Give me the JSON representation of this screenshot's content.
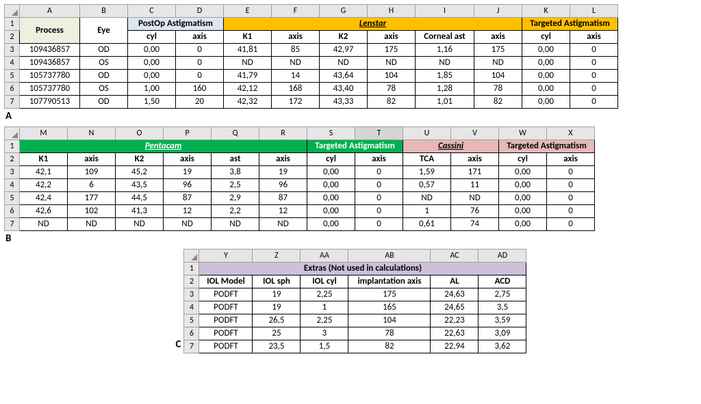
{
  "labels": {
    "A": "A",
    "B": "B",
    "C": "C"
  },
  "tableA": {
    "cols": [
      "A",
      "B",
      "C",
      "D",
      "E",
      "F",
      "G",
      "H",
      "I",
      "J",
      "K",
      "L"
    ],
    "widths": [
      88,
      70,
      70,
      70,
      70,
      70,
      70,
      70,
      86,
      70,
      70,
      70
    ],
    "rownums": [
      "1",
      "2",
      "3",
      "4",
      "5",
      "6",
      "7"
    ],
    "groups": {
      "process": "Process",
      "eye": "Eye",
      "postop": "PostOp Astigmatism",
      "lenstar": "Lenstar",
      "target": "Targeted Astigmatism"
    },
    "sub": [
      "cyl",
      "axis",
      "K1",
      "axis",
      "K2",
      "axis",
      "Corneal ast",
      "axis",
      "cyl",
      "axis"
    ],
    "rows": [
      [
        "109436857",
        "OD",
        "0,00",
        "0",
        "41,81",
        "85",
        "42,97",
        "175",
        "1,16",
        "175",
        "0,00",
        "0"
      ],
      [
        "109436857",
        "OS",
        "0,00",
        "0",
        "ND",
        "ND",
        "ND",
        "ND",
        "ND",
        "ND",
        "0,00",
        "0"
      ],
      [
        "105737780",
        "OD",
        "0,00",
        "0",
        "41,79",
        "14",
        "43,64",
        "104",
        "1,85",
        "104",
        "0,00",
        "0"
      ],
      [
        "105737780",
        "OS",
        "1,00",
        "160",
        "42,12",
        "168",
        "43,40",
        "78",
        "1,28",
        "78",
        "0,00",
        "0"
      ],
      [
        "107790513",
        "OD",
        "1,50",
        "20",
        "42,32",
        "172",
        "43,33",
        "82",
        "1,01",
        "82",
        "0,00",
        "0"
      ]
    ]
  },
  "tableB": {
    "cols": [
      "M",
      "N",
      "O",
      "P",
      "Q",
      "R",
      "S",
      "T",
      "U",
      "V",
      "W",
      "X"
    ],
    "widths": [
      70,
      70,
      70,
      70,
      70,
      70,
      70,
      70,
      70,
      70,
      70,
      70
    ],
    "rownums": [
      "1",
      "2",
      "3",
      "4",
      "5",
      "6",
      "7"
    ],
    "groups": {
      "pentacam": "Pentacam",
      "ptarget": "Targeted Astigmatism",
      "cassini": "Cassini",
      "ctarget": "Targeted Astigmatism"
    },
    "sub": [
      "K1",
      "axis",
      "K2",
      "axis",
      "ast",
      "axis",
      "cyl",
      "axis",
      "TCA",
      "axis",
      "cyl",
      "axis"
    ],
    "rows": [
      [
        "42,1",
        "109",
        "45,2",
        "19",
        "3,8",
        "19",
        "0,00",
        "0",
        "1,59",
        "171",
        "0,00",
        "0"
      ],
      [
        "42,2",
        "6",
        "43,5",
        "96",
        "2,5",
        "96",
        "0,00",
        "0",
        "0,57",
        "11",
        "0,00",
        "0"
      ],
      [
        "42,4",
        "177",
        "44,5",
        "87",
        "2,9",
        "87",
        "0,00",
        "0",
        "ND",
        "ND",
        "0,00",
        "0"
      ],
      [
        "42,6",
        "102",
        "41,3",
        "12",
        "2,2",
        "12",
        "0,00",
        "0",
        "1",
        "76",
        "0,00",
        "0"
      ],
      [
        "ND",
        "ND",
        "ND",
        "ND",
        "ND",
        "ND",
        "0,00",
        "0",
        "0,61",
        "74",
        "0,00",
        "0"
      ]
    ]
  },
  "tableC": {
    "cols": [
      "Y",
      "Z",
      "AA",
      "AB",
      "AC",
      "AD"
    ],
    "widths": [
      78,
      70,
      70,
      120,
      70,
      70
    ],
    "rownums": [
      "1",
      "2",
      "3",
      "4",
      "5",
      "6",
      "7"
    ],
    "group": "Extras (Not used in calculations)",
    "sub": [
      "IOL Model",
      "IOL sph",
      "IOL cyl",
      "implantation axis",
      "AL",
      "ACD"
    ],
    "rows": [
      [
        "PODFT",
        "19",
        "2,25",
        "175",
        "24,63",
        "2,75"
      ],
      [
        "PODFT",
        "19",
        "1",
        "165",
        "24,65",
        "3,5"
      ],
      [
        "PODFT",
        "26,5",
        "2,25",
        "104",
        "22,23",
        "3,59"
      ],
      [
        "PODFT",
        "25",
        "3",
        "78",
        "22,63",
        "3,09"
      ],
      [
        "PODFT",
        "23,5",
        "1,5",
        "82",
        "22,94",
        "3,62"
      ]
    ]
  }
}
